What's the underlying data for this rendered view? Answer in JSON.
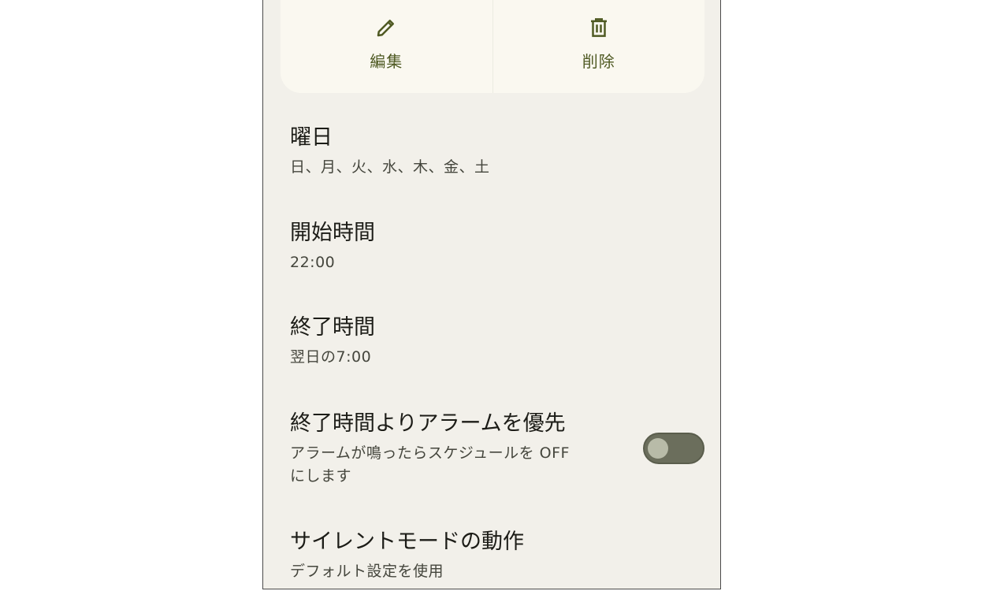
{
  "actions": {
    "edit_label": "編集",
    "delete_label": "削除",
    "edit_icon": "pencil-icon",
    "delete_icon": "trash-icon",
    "accent_color": "#4f5a23"
  },
  "settings": [
    {
      "title": "曜日",
      "subtitle": "日、月、火、水、木、金、土"
    },
    {
      "title": "開始時間",
      "subtitle": "22:00"
    },
    {
      "title": "終了時間",
      "subtitle": "翌日の7:00"
    },
    {
      "title": "終了時間よりアラームを優先",
      "subtitle": "アラームが鳴ったらスケジュールを OFF にします",
      "toggle_on": false
    },
    {
      "title": "サイレントモードの動作",
      "subtitle": "デフォルト設定を使用"
    }
  ]
}
